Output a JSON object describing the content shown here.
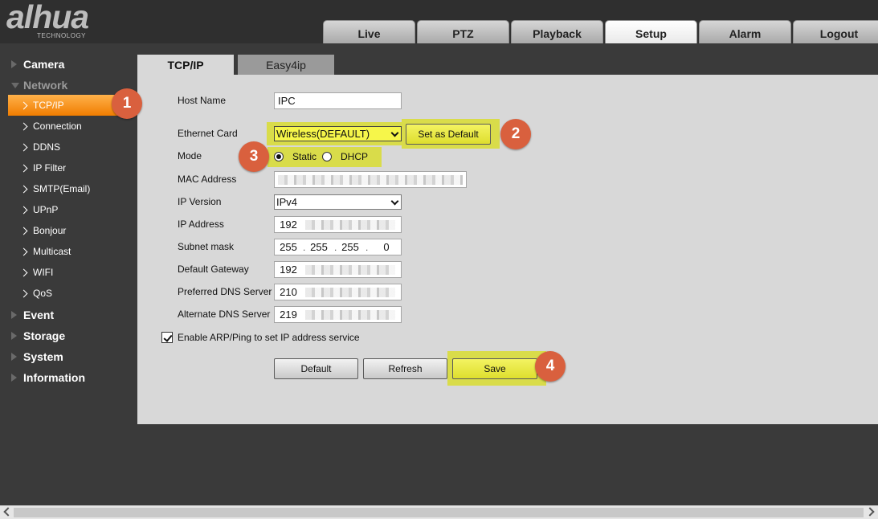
{
  "logo": {
    "main": "alhua",
    "sub": "TECHNOLOGY"
  },
  "top_tabs": [
    "Live",
    "PTZ",
    "Playback",
    "Setup",
    "Alarm",
    "Logout"
  ],
  "sidebar": {
    "camera": "Camera",
    "network": "Network",
    "network_items": [
      "TCP/IP",
      "Connection",
      "DDNS",
      "IP Filter",
      "SMTP(Email)",
      "UPnP",
      "Bonjour",
      "Multicast",
      "WIFI",
      "QoS"
    ],
    "event": "Event",
    "storage": "Storage",
    "system": "System",
    "information": "Information"
  },
  "main_tabs": {
    "tcpip": "TCP/IP",
    "easy4ip": "Easy4ip"
  },
  "form": {
    "host_name_label": "Host Name",
    "host_name_value": "IPC",
    "ethernet_card_label": "Ethernet Card",
    "ethernet_card_value": "Wireless(DEFAULT)",
    "set_default_label": "Set as Default",
    "mode_label": "Mode",
    "mode_static": "Static",
    "mode_dhcp": "DHCP",
    "mac_label": "MAC Address",
    "ip_version_label": "IP Version",
    "ip_version_value": "IPv4",
    "ip_address_label": "IP Address",
    "ip_address_first": "192",
    "subnet_label": "Subnet mask",
    "subnet_octets": [
      "255",
      "255",
      "255",
      "0"
    ],
    "gateway_label": "Default Gateway",
    "gateway_first": "192",
    "pref_dns_label": "Preferred DNS Server",
    "pref_dns_first": "210",
    "alt_dns_label": "Alternate DNS Server",
    "alt_dns_first": "219",
    "arp_label": "Enable ARP/Ping to set IP address service"
  },
  "buttons": {
    "default": "Default",
    "refresh": "Refresh",
    "save": "Save"
  },
  "badges": [
    "1",
    "2",
    "3",
    "4"
  ],
  "colors": {
    "accent_orange": "#f07d00",
    "highlight_yellow": "#d9dc4a",
    "badge": "#d9603e"
  }
}
